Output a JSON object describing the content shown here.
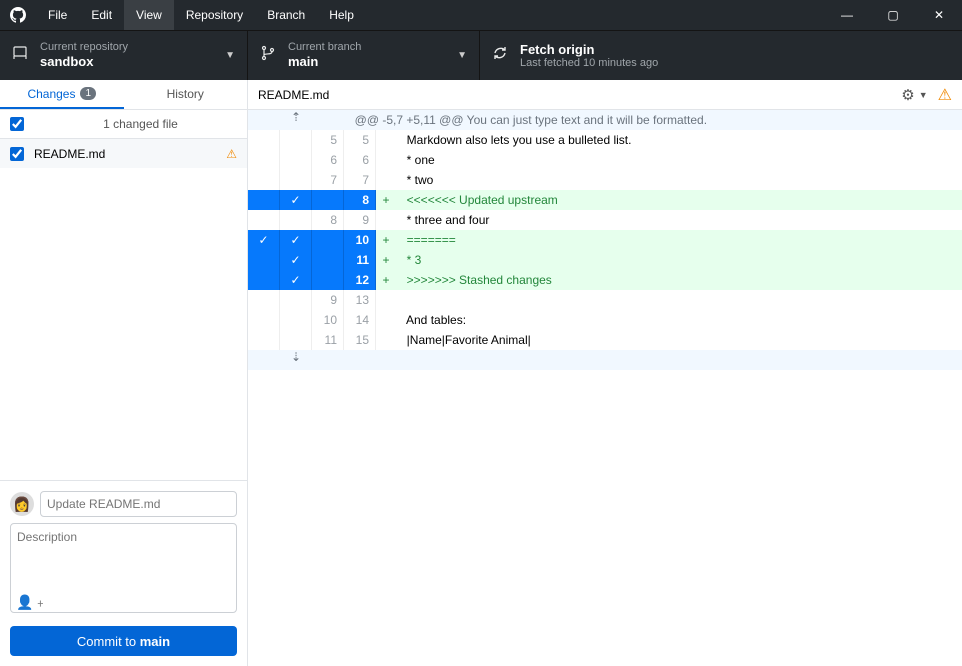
{
  "menu": {
    "items": [
      "File",
      "Edit",
      "View",
      "Repository",
      "Branch",
      "Help"
    ],
    "active_index": 2
  },
  "window_controls": {
    "min": "—",
    "max": "▢",
    "close": "✕"
  },
  "toolbar": {
    "repo": {
      "label": "Current repository",
      "value": "sandbox"
    },
    "branch": {
      "label": "Current branch",
      "value": "main"
    },
    "fetch": {
      "title": "Fetch origin",
      "sub": "Last fetched 10 minutes ago"
    }
  },
  "tabs": {
    "changes": "Changes",
    "changes_count": "1",
    "history": "History"
  },
  "file_header": {
    "label": "1 changed file"
  },
  "file": {
    "name": "README.md"
  },
  "commit": {
    "summary_placeholder": "Update README.md",
    "desc_placeholder": "Description",
    "button_prefix": "Commit to ",
    "button_branch": "main"
  },
  "diff": {
    "file": "README.md",
    "hunk_header": "@@ -5,7 +5,11 @@ You can just type text and it will be formatted.",
    "expand_top": "⇡",
    "expand_bot": "⇣",
    "lines": [
      {
        "type": "ctx",
        "old": "5",
        "new": "5",
        "text": "Markdown also lets you use a bulleted list."
      },
      {
        "type": "ctx",
        "old": "6",
        "new": "6",
        "text": "* one"
      },
      {
        "type": "ctx",
        "old": "7",
        "new": "7",
        "text": "* two"
      },
      {
        "type": "add",
        "old": "",
        "new": "8",
        "text": "<<<<<<< Updated upstream",
        "sel": true
      },
      {
        "type": "ctx",
        "old": "8",
        "new": "9",
        "text": "* three and four"
      },
      {
        "type": "add",
        "old": "",
        "new": "10",
        "text": "=======",
        "sel": true,
        "grp": true
      },
      {
        "type": "add",
        "old": "",
        "new": "11",
        "text": "* 3",
        "sel": true
      },
      {
        "type": "add",
        "old": "",
        "new": "12",
        "text": ">>>>>>> Stashed changes",
        "sel": true
      },
      {
        "type": "ctx",
        "old": "9",
        "new": "13",
        "text": ""
      },
      {
        "type": "ctx",
        "old": "10",
        "new": "14",
        "text": "And tables:"
      },
      {
        "type": "ctx",
        "old": "11",
        "new": "15",
        "text": "|Name|Favorite Animal|"
      }
    ]
  }
}
